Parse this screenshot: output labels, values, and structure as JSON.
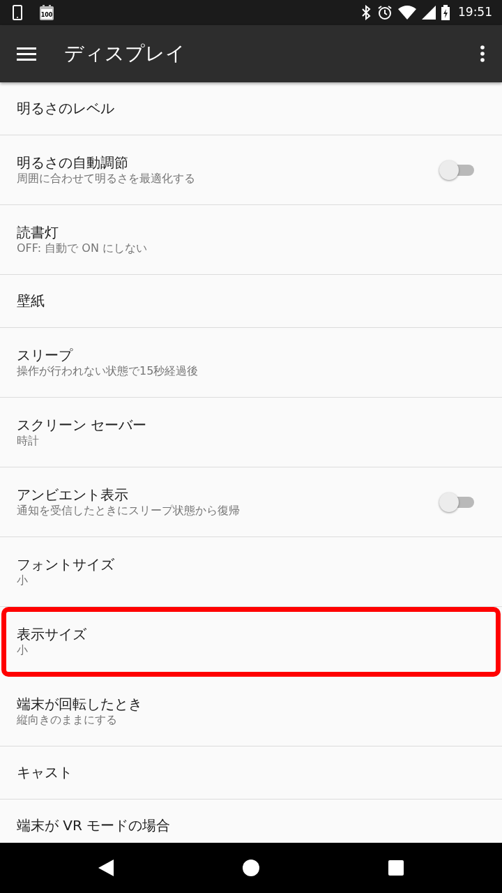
{
  "status_bar": {
    "app_icon_text": "100",
    "time": "19:51"
  },
  "app_bar": {
    "title": "ディスプレイ"
  },
  "settings": [
    {
      "title": "明るさのレベル",
      "kind": "plain"
    },
    {
      "title": "明るさの自動調節",
      "subtitle": "周囲に合わせて明るさを最適化する",
      "kind": "switch",
      "on": false
    },
    {
      "title": "読書灯",
      "subtitle": "OFF: 自動で ON にしない",
      "kind": "plain"
    },
    {
      "title": "壁紙",
      "kind": "plain"
    },
    {
      "title": "スリープ",
      "subtitle": "操作が行われない状態で15秒経過後",
      "kind": "plain"
    },
    {
      "title": "スクリーン セーバー",
      "subtitle": "時計",
      "kind": "plain"
    },
    {
      "title": "アンビエント表示",
      "subtitle": "通知を受信したときにスリープ状態から復帰",
      "kind": "switch",
      "on": false
    },
    {
      "title": "フォントサイズ",
      "subtitle": "小",
      "kind": "plain"
    },
    {
      "title": "表示サイズ",
      "subtitle": "小",
      "kind": "plain",
      "highlighted": true
    },
    {
      "title": "端末が回転したとき",
      "subtitle": "縦向きのままにする",
      "kind": "plain"
    },
    {
      "title": "キャスト",
      "kind": "plain"
    },
    {
      "title": "端末が VR モードの場合",
      "kind": "plain"
    }
  ]
}
